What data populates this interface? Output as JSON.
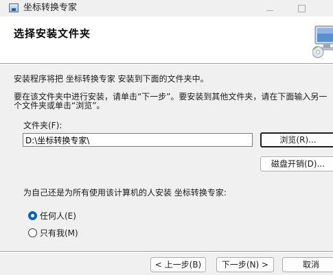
{
  "window": {
    "title": "坐标转换专家",
    "minimize_symbol": "—",
    "maximize_symbol": "☐"
  },
  "header": {
    "title": "选择安装文件夹",
    "graphic_icon": "computer-cd-icon"
  },
  "body": {
    "intro": "安装程序将把 坐标转换专家 安装到下面的文件夹中。",
    "instructions_line1": "要在该文件夹中进行安装，请单击“下一步”。要安装到其他文件夹，请在下面输入另一",
    "instructions_line2": "个文件夹或单击“浏览”。",
    "folder_label": "文件夹(F):",
    "folder_value": "D:\\坐标转换专家\\",
    "browse_button": "浏览(R)...",
    "disk_cost_button": "磁盘开销(D)...",
    "install_for_prompt": "为自己还是为所有使用该计算机的人安装 坐标转换专家:",
    "options": {
      "everyone": "任何人(E)",
      "only_me": "只有我(M)",
      "selected": "everyone"
    }
  },
  "footer": {
    "back_button": "< 上一步(B)",
    "next_button": "下一步(N) >",
    "cancel_button": "取消"
  },
  "colors": {
    "accent": "#0067c0",
    "panel_bg": "#f0f0f0",
    "header_bg": "#ffffff"
  }
}
